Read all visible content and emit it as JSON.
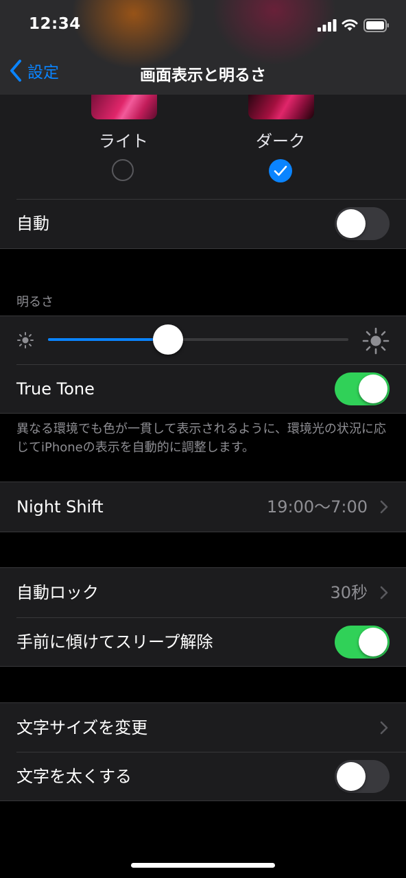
{
  "status": {
    "time": "12:34"
  },
  "nav": {
    "back_label": "設定",
    "title": "画面表示と明るさ"
  },
  "appearance": {
    "light_label": "ライト",
    "dark_label": "ダーク",
    "selected": "dark",
    "auto_label": "自動",
    "auto_on": false
  },
  "brightness": {
    "header": "明るさ",
    "level": 0.4,
    "true_tone_label": "True Tone",
    "true_tone_on": true,
    "true_tone_footnote": "異なる環境でも色が一貫して表示されるように、環境光の状況に応じてiPhoneの表示を自動的に調整します。"
  },
  "night_shift": {
    "label": "Night Shift",
    "value": "19:00〜7:00"
  },
  "lock": {
    "auto_lock_label": "自動ロック",
    "auto_lock_value": "30秒",
    "raise_to_wake_label": "手前に傾けてスリープ解除",
    "raise_to_wake_on": true
  },
  "text": {
    "text_size_label": "文字サイズを変更",
    "bold_text_label": "文字を太くする",
    "bold_text_on": false
  },
  "colors": {
    "accent": "#0a84ff",
    "toggle_on": "#30d158",
    "cell_bg": "#1c1c1e"
  },
  "icons": [
    "chevron-left-icon",
    "cellular-signal-icon",
    "wifi-icon",
    "battery-icon",
    "checkmark-icon",
    "brightness-low-icon",
    "brightness-high-icon",
    "chevron-right-icon"
  ]
}
